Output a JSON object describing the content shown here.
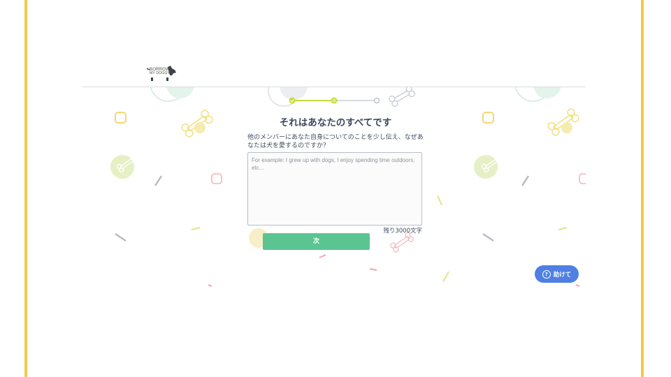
{
  "logo": {
    "line1": "BORROW",
    "line2": "MY DOGGY"
  },
  "progress": {
    "total_steps": 3,
    "current_step": 2
  },
  "page": {
    "title": "それはあなたのすべてです",
    "prompt": "他のメンバーにあなた自身についてのことを少し伝え、なぜあなたは犬を愛するのですか？",
    "textarea_placeholder": "For example: I grew up with dogs, I enjoy spending time outdoors, etc...",
    "textarea_value": "",
    "counter": "残り3000文字",
    "next_label": "次"
  },
  "help": {
    "icon": "question-circle-icon",
    "label": "助けて"
  },
  "colors": {
    "accent_green": "#5bc592",
    "progress_green": "#c4dd3b",
    "help_blue": "#4f80e1",
    "frame_yellow": "#f2c94c",
    "text_dark": "#3d4a5c"
  }
}
